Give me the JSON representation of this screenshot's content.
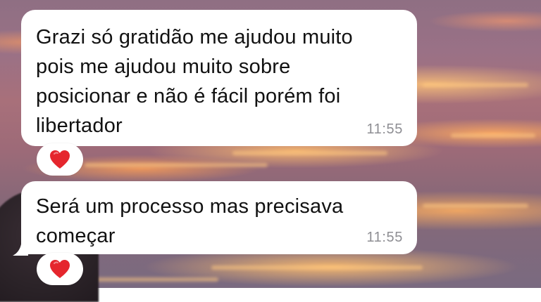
{
  "messages": [
    {
      "text": "Grazi só gratidão me ajudou muito\npois me ajudou muito sobre\nposicionar e não é fácil porém foi\nlibertador",
      "time": "11:55",
      "reaction": "heart-icon"
    },
    {
      "text": "Será um processo mas precisava\ncomeçar",
      "time": "11:55",
      "reaction": "heart-icon"
    }
  ],
  "colors": {
    "bubble": "#ffffff",
    "text": "#111111",
    "timestamp": "#8e8e93",
    "heart": "#e5262d"
  }
}
